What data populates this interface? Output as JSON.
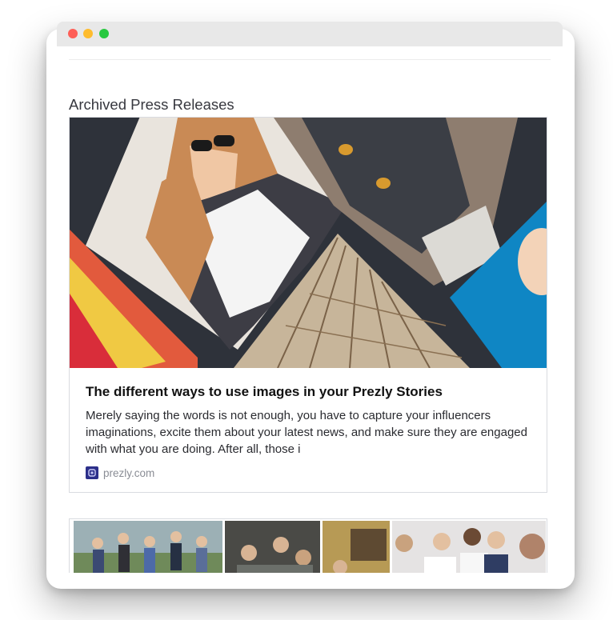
{
  "window": {
    "controls": [
      "close",
      "minimize",
      "zoom"
    ],
    "colors": {
      "close": "#fe5f57",
      "minimize": "#febc2e",
      "zoom": "#28c840"
    }
  },
  "section": {
    "heading": "Archived Press Releases"
  },
  "story": {
    "title": "The different ways to use images in your Prezly Stories",
    "excerpt": "Merely saying the words is not enough, you have to capture your influencers imaginations, excite them about your latest news, and make sure they are engaged with what you are doing. After all, those i",
    "source": "prezly.com",
    "source_icon": "prezly-logo-icon"
  },
  "next_story": {
    "image": "team-photo-collage"
  },
  "colors": {
    "brand": "#2c2f8a",
    "muted": "#8a8d95",
    "card_border": "#d9dbe0"
  }
}
